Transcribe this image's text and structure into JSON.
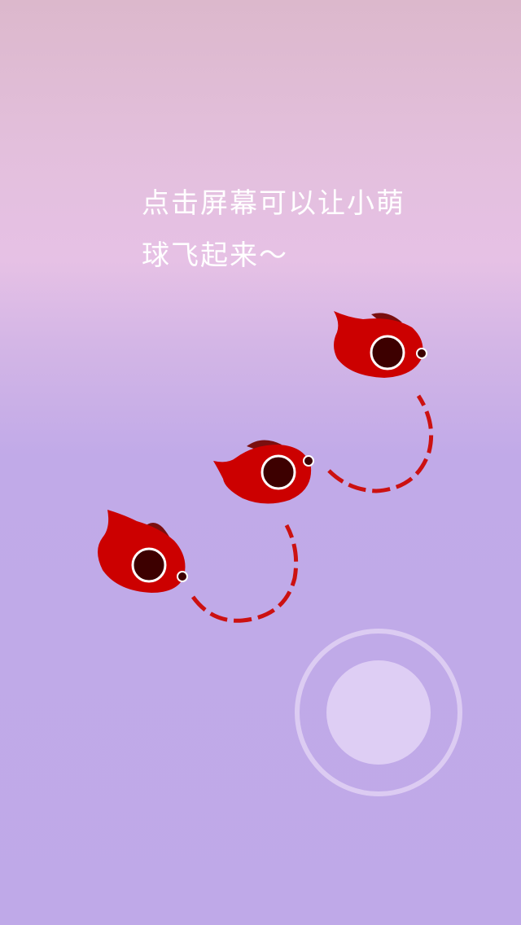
{
  "tutorial": {
    "hint_line_1": "点击屏幕可以让小萌",
    "hint_line_2": "球飞起来～"
  },
  "colors": {
    "creature_body": "#cc0000",
    "creature_fin": "#7a0f0f",
    "creature_eye_ring": "#ffffff",
    "creature_pupil": "#3d0000",
    "trail": "#cc1111",
    "button_ring": "#e6d7f5",
    "button_core": "#e1d2f5"
  },
  "icons": {
    "creature": "red-ball-creature-icon",
    "trail": "dashed-arc-trail",
    "tap_button": "circle-tap-button"
  }
}
